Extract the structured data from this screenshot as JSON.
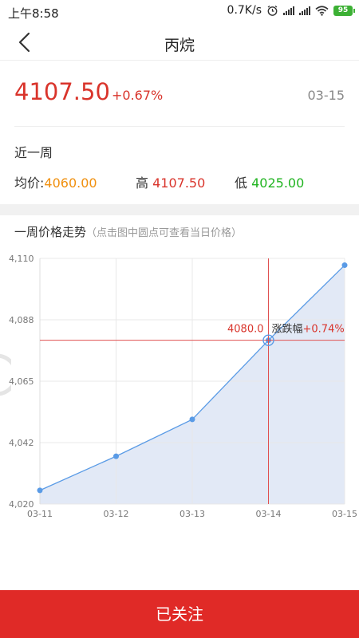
{
  "status_bar": {
    "time": "上午8:58",
    "speed": "0.7K/s",
    "battery": "95"
  },
  "header": {
    "title": "丙烷"
  },
  "quote": {
    "price": "4107.50",
    "change": "+0.67%",
    "date": "03-15"
  },
  "week": {
    "label": "近一周",
    "avg_label": "均价:",
    "avg_value": "4060.00",
    "high_label": "高",
    "high_value": "4107.50",
    "low_label": "低",
    "low_value": "4025.00"
  },
  "chart_section": {
    "title": "一周价格走势",
    "hint": "（点击图中圆点可查看当日价格）"
  },
  "chart_data": {
    "type": "area",
    "categories": [
      "03-11",
      "03-12",
      "03-13",
      "03-14",
      "03-15"
    ],
    "values": [
      4025.0,
      4037.5,
      4051.0,
      4080.0,
      4107.5
    ],
    "y_ticks": [
      "4,020",
      "4,042",
      "4,065",
      "4,088",
      "4,110"
    ],
    "ylim": [
      4020,
      4110
    ],
    "grid": true,
    "selected_index": 3,
    "tooltip_value": "4080.0",
    "tooltip_label": "涨跌幅",
    "tooltip_change": "+0.74%",
    "colors": {
      "line": "#5a9be6",
      "fill": "#e2e9f6",
      "crosshair": "#e05050"
    }
  },
  "footer": {
    "follow_label": "已关注"
  }
}
